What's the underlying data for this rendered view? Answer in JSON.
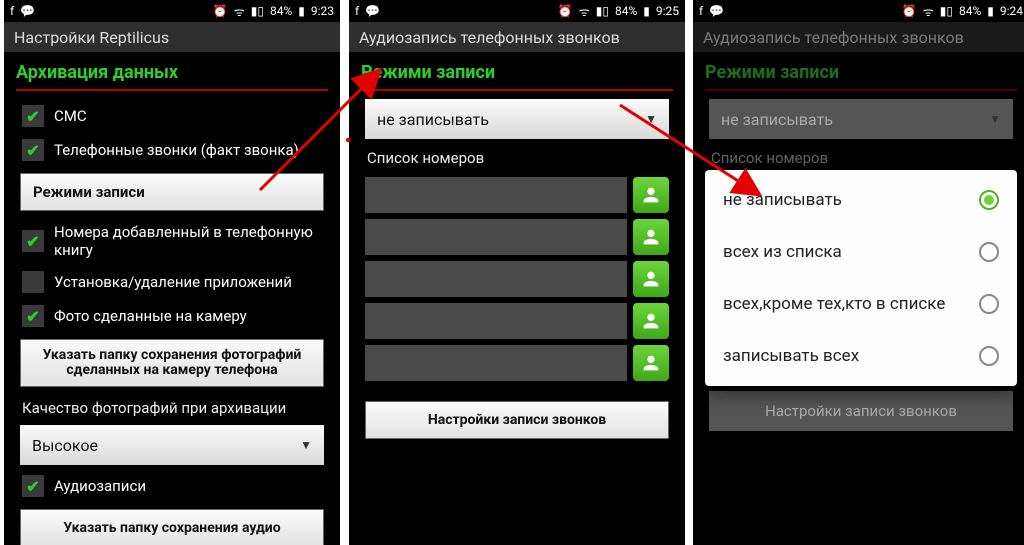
{
  "status": {
    "battery": "84%",
    "times": {
      "p1": "9:23",
      "p2": "9:25",
      "p3": "9:24"
    }
  },
  "p1": {
    "app_title": "Настройки Reptilicus",
    "section": "Архивация данных",
    "chk_sms": "СМС",
    "chk_calls": "Телефонные звонки (факт звонка)",
    "btn_record_modes": "Режими записи",
    "chk_contacts": "Номера добавленный в телефонную книгу",
    "chk_apps": "Установка/удаление приложений",
    "chk_photos": "Фото сделанные на камеру",
    "btn_photo_folder": "Указать папку сохранения фотографий сделанных на камеру телефона",
    "quality_label": "Качество фотографий при архивации",
    "quality_value": "Высокое",
    "chk_audio": "Аудиозаписи",
    "btn_audio_folder": "Указать папку сохранения аудио"
  },
  "p2": {
    "app_title": "Аудиозапись телефонных звонков",
    "section": "Режими записи",
    "select_value": "не записывать",
    "list_label": "Список номеров",
    "btn_settings": "Настройки записи звонков"
  },
  "p3": {
    "app_title": "Аудиозапись телефонных звонков",
    "section": "Режими записи",
    "select_value": "не записывать",
    "list_label": "Список номеров",
    "btn_settings": "Настройки записи звонков",
    "options": [
      "не записывать",
      "всех из списка",
      "всех,кроме тех,кто в списке",
      "записывать всех"
    ],
    "selected_index": 0
  }
}
